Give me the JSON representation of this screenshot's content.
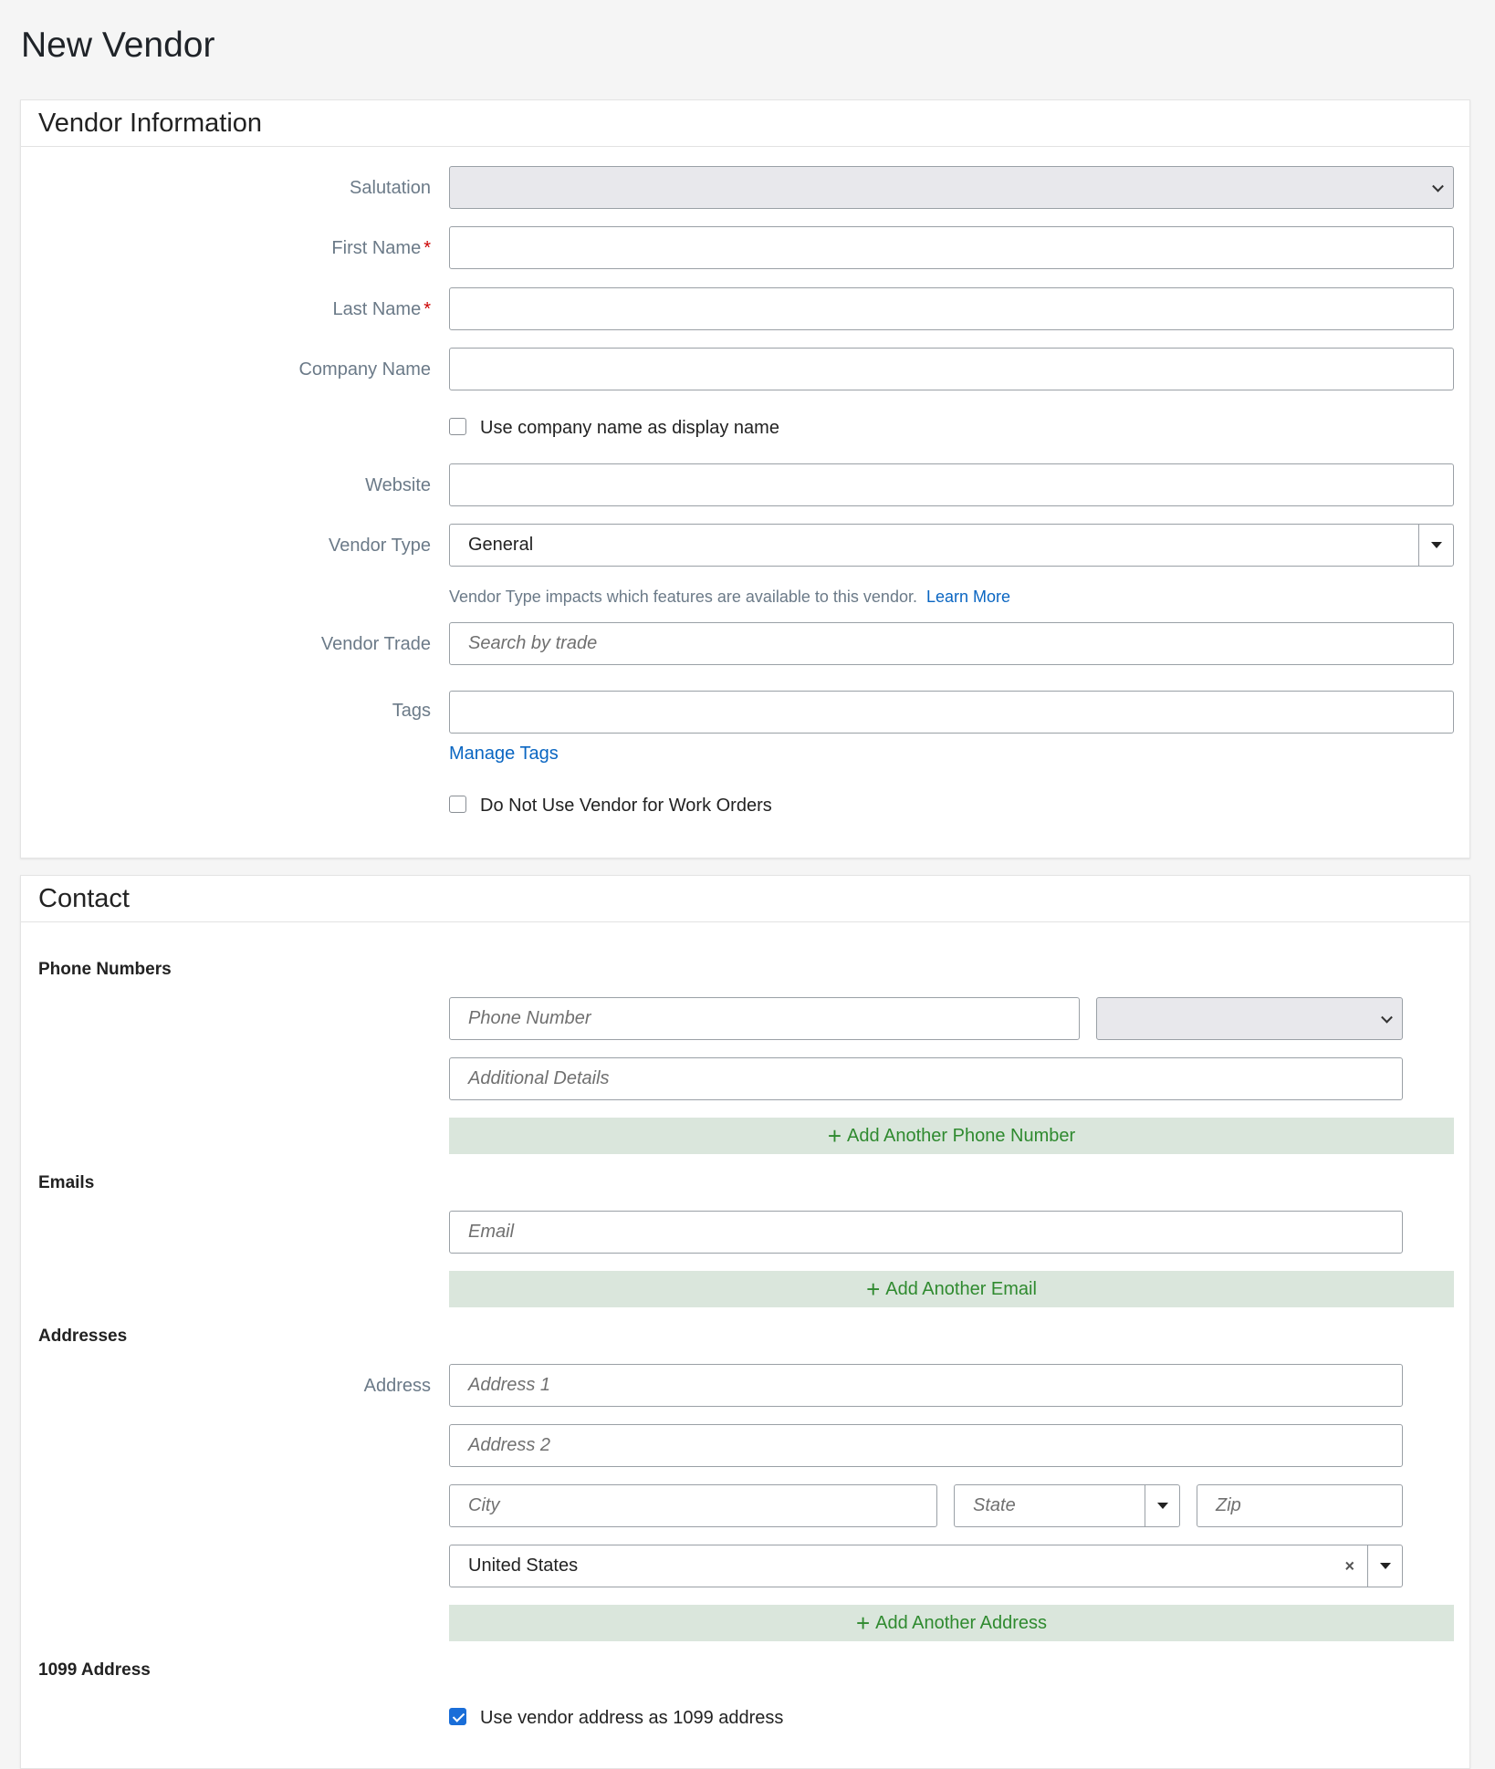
{
  "page": {
    "title": "New Vendor"
  },
  "vendor_info": {
    "header": "Vendor Information",
    "salutation_label": "Salutation",
    "salutation_value": "",
    "first_name_label": "First Name",
    "last_name_label": "Last Name",
    "required_mark": "*",
    "company_name_label": "Company Name",
    "use_company_name_label": "Use company name as display name",
    "use_company_name_checked": false,
    "website_label": "Website",
    "vendor_type_label": "Vendor Type",
    "vendor_type_value": "General",
    "vendor_type_help": "Vendor Type impacts which features are available to this vendor.",
    "learn_more": "Learn More",
    "vendor_trade_label": "Vendor Trade",
    "vendor_trade_placeholder": "Search by trade",
    "tags_label": "Tags",
    "manage_tags": "Manage Tags",
    "do_not_use_label": "Do Not Use Vendor for Work Orders",
    "do_not_use_checked": false
  },
  "contact": {
    "header": "Contact",
    "phone_numbers_title": "Phone Numbers",
    "phone_placeholder": "Phone Number",
    "phone_type_value": "",
    "additional_details_placeholder": "Additional Details",
    "add_phone": "Add Another Phone Number",
    "emails_title": "Emails",
    "email_placeholder": "Email",
    "add_email": "Add Another Email",
    "addresses_title": "Addresses",
    "address_label": "Address",
    "address1_placeholder": "Address 1",
    "address2_placeholder": "Address 2",
    "city_placeholder": "City",
    "state_placeholder": "State",
    "zip_placeholder": "Zip",
    "country_value": "United States",
    "clear_symbol": "×",
    "add_address": "Add Another Address",
    "address_1099_title": "1099 Address",
    "use_vendor_address_label": "Use vendor address as 1099 address",
    "use_vendor_address_checked": true
  },
  "icons": {
    "plus": "+",
    "chevron": "chevron-down-icon",
    "caret": "caret-down-icon"
  },
  "colors": {
    "link": "#0a66c2",
    "add_button_bg": "#dae6dc",
    "add_button_text": "#2f8a2f",
    "checkbox_checked": "#1a6ed8",
    "required": "#cc0000"
  }
}
